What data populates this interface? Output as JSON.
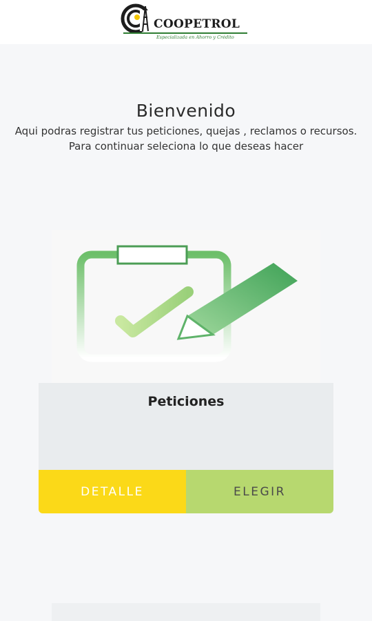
{
  "header": {
    "logo_name": "COOPETROL",
    "logo_tagline": "Especializada en Ahorro y Crédito"
  },
  "welcome": {
    "title": "Bienvenido",
    "line1": "Aqui podras registrar tus peticiones, quejas , reclamos o recursos.",
    "line2": "Para continuar seleciona lo que deseas hacer"
  },
  "cards": [
    {
      "title": "Peticiones",
      "icon": "clipboard-check-pencil-icon",
      "detail_label": "DETALLE",
      "choose_label": "ELEGIR"
    }
  ],
  "colors": {
    "detail_button": "#fbd918",
    "choose_button": "#b7d86f",
    "brand_green": "#2e7d32",
    "card_body": "#e9ecee"
  }
}
